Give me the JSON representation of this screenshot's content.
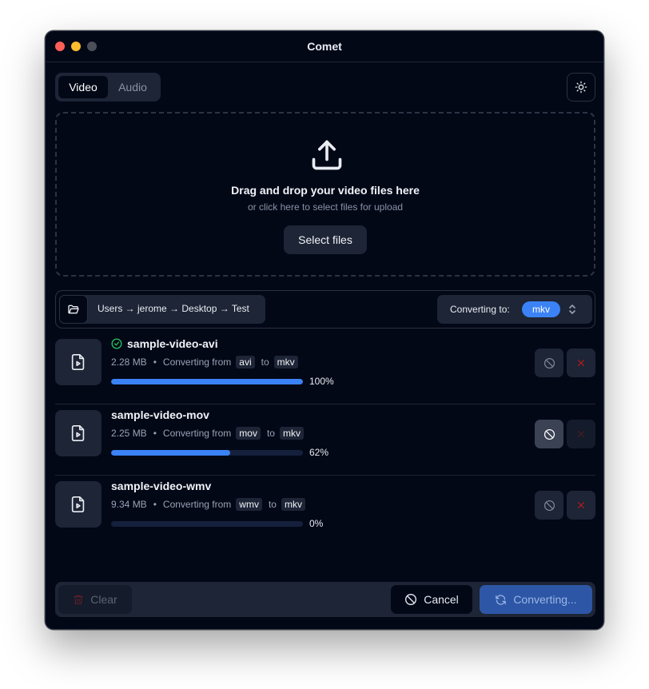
{
  "window": {
    "title": "Comet"
  },
  "tabs": [
    {
      "label": "Video",
      "active": true
    },
    {
      "label": "Audio",
      "active": false
    }
  ],
  "dropzone": {
    "title": "Drag and drop your video files here",
    "subtitle": "or click here to select files for upload",
    "button": "Select files"
  },
  "pathbar": {
    "path": "Users → jerome → Desktop → Test",
    "converting_label": "Converting to:",
    "target_format": "mkv"
  },
  "files": [
    {
      "name": "sample-video-avi",
      "size": "2.28 MB",
      "converting_from_label": "Converting from",
      "from": "avi",
      "to_label": "to",
      "to": "mkv",
      "progress_percent": 100,
      "progress_text": "100%",
      "status": "done"
    },
    {
      "name": "sample-video-mov",
      "size": "2.25 MB",
      "converting_from_label": "Converting from",
      "from": "mov",
      "to_label": "to",
      "to": "mkv",
      "progress_percent": 62,
      "progress_text": "62%",
      "status": "converting"
    },
    {
      "name": "sample-video-wmv",
      "size": "9.34 MB",
      "converting_from_label": "Converting from",
      "from": "wmv",
      "to_label": "to",
      "to": "mkv",
      "progress_percent": 0,
      "progress_text": "0%",
      "status": "queued"
    }
  ],
  "footer": {
    "clear_label": "Clear",
    "cancel_label": "Cancel",
    "convert_label": "Converting..."
  },
  "colors": {
    "background": "#030817",
    "accent": "#3b82f6",
    "danger": "#b91c1c",
    "success": "#22c55e"
  }
}
